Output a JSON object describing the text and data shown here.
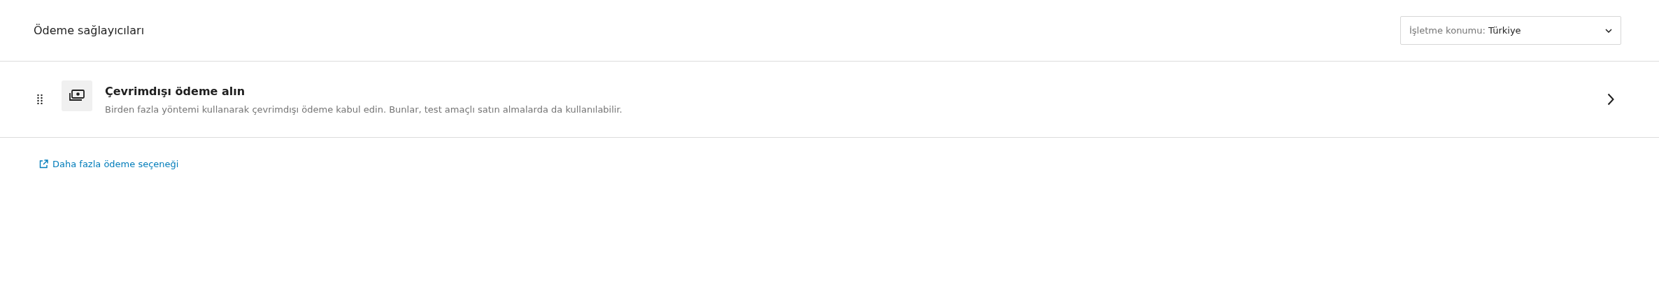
{
  "header": {
    "title": "Ödeme sağlayıcıları",
    "location_select": {
      "label": "İşletme konumu:",
      "value": "Türkiye"
    }
  },
  "providers": [
    {
      "title": "Çevrimdışı ödeme alın",
      "description": "Birden fazla yöntemi kullanarak çevrimdışı ödeme kabul edin. Bunlar, test amaçlı satın almalarda da kullanılabilir."
    }
  ],
  "more_link": {
    "label": "Daha fazla ödeme seçeneği"
  }
}
